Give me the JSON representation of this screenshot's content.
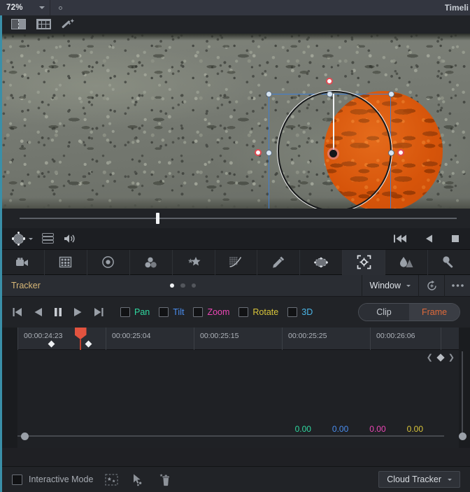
{
  "topbar": {
    "zoom_level": "72%",
    "zoom_chevron_icon": "chevron-down-icon",
    "status_dot_icon": "circle-outline-icon",
    "title": "Timeli"
  },
  "viewer_toolbar": {
    "buttons": [
      {
        "name": "split-screen-icon",
        "label": "Split Screen"
      },
      {
        "name": "grid-view-icon",
        "label": "Grid View"
      },
      {
        "name": "magic-wand-icon",
        "label": "Enhance"
      }
    ]
  },
  "viewer": {
    "overlay": "circular-power-window",
    "mask_color": "#d9570c",
    "box_color": "#3f7fd4",
    "handle_color": "#d6e4f2",
    "softness_handle_color": "#e04a52"
  },
  "viewer_controls": {
    "power_window_icon": "power-window-icon",
    "power_window_chevron": "chevron-down-icon",
    "layers_icon": "layers-icon",
    "audio_icon": "speaker-icon",
    "transport": [
      {
        "name": "jump-to-start-button",
        "icon": "skip-back-icon"
      },
      {
        "name": "play-reverse-button",
        "icon": "play-reverse-icon"
      },
      {
        "name": "stop-button",
        "icon": "stop-icon"
      }
    ]
  },
  "palette": {
    "items": [
      {
        "name": "palette-camera-raw",
        "icon": "camera-icon",
        "active": false
      },
      {
        "name": "palette-color-match",
        "icon": "grid-palette-icon",
        "active": false
      },
      {
        "name": "palette-color-wheels",
        "icon": "color-wheel-icon",
        "active": false
      },
      {
        "name": "palette-color-warper",
        "icon": "color-blobs-icon",
        "active": false
      },
      {
        "name": "palette-magic-mask",
        "icon": "magic-star-icon",
        "active": false
      },
      {
        "name": "palette-curves",
        "icon": "curves-icon",
        "active": false
      },
      {
        "name": "palette-qualifier",
        "icon": "eyedropper-icon",
        "active": false
      },
      {
        "name": "palette-power-windows",
        "icon": "window-ellipse-icon",
        "active": false
      },
      {
        "name": "palette-tracker",
        "icon": "tracker-crosshair-icon",
        "active": true
      },
      {
        "name": "palette-blur",
        "icon": "blur-sharpen-icon",
        "active": false
      },
      {
        "name": "palette-key",
        "icon": "key-icon",
        "active": false
      }
    ]
  },
  "tracker_panel": {
    "title": "Tracker",
    "page_dots": [
      true,
      false,
      false
    ],
    "mode_label": "Window",
    "mode_chevron_icon": "chevron-down-icon",
    "reset_icon": "reset-circle-icon",
    "options_icon": "more-options-icon"
  },
  "tracker_controls": {
    "transport": [
      {
        "name": "track-reverse-to-start-button",
        "icon": "skip-back-icon"
      },
      {
        "name": "track-reverse-button",
        "icon": "play-reverse-icon"
      },
      {
        "name": "pause-button",
        "icon": "pause-icon"
      },
      {
        "name": "track-forward-button",
        "icon": "play-forward-icon"
      },
      {
        "name": "track-forward-to-end-button",
        "icon": "skip-forward-icon"
      }
    ],
    "checkboxes": [
      {
        "label": "Pan",
        "color": "#2fd9a0",
        "checked": false
      },
      {
        "label": "Tilt",
        "color": "#4a8ef0",
        "checked": false
      },
      {
        "label": "Zoom",
        "color": "#ec46b6",
        "checked": false
      },
      {
        "label": "Rotate",
        "color": "#d9c53a",
        "checked": false
      },
      {
        "label": "3D",
        "color": "#4ab6e8",
        "checked": false
      }
    ],
    "segmented": {
      "options": [
        "Clip",
        "Frame"
      ],
      "selected": "Frame",
      "selected_color": "#e06a3a"
    }
  },
  "timeline": {
    "timecodes": [
      "00:00:24:23",
      "00:00:25:04",
      "00:00:25:15",
      "00:00:25:25",
      "00:00:26:06"
    ],
    "keyframe_nav": {
      "prev_icon": "chevron-left-icon",
      "marker_icon": "keyframe-diamond-icon",
      "next_icon": "chevron-right-icon"
    },
    "values": [
      {
        "text": "0.00",
        "color": "#2fd9a0"
      },
      {
        "text": "0.00",
        "color": "#4a8ef0"
      },
      {
        "text": "0.00",
        "color": "#ec46b6"
      },
      {
        "text": "0.00",
        "color": "#d9c53a"
      }
    ],
    "playhead_color": "#e2533f"
  },
  "bottom_bar": {
    "interactive_mode_label": "Interactive Mode",
    "interactive_mode_checked": false,
    "icons": [
      {
        "name": "insert-track-point-icon"
      },
      {
        "name": "cursor-add-point-icon"
      },
      {
        "name": "delete-track-point-icon"
      }
    ],
    "tracker_type_label": "Cloud Tracker",
    "tracker_type_chevron_icon": "chevron-down-icon"
  }
}
